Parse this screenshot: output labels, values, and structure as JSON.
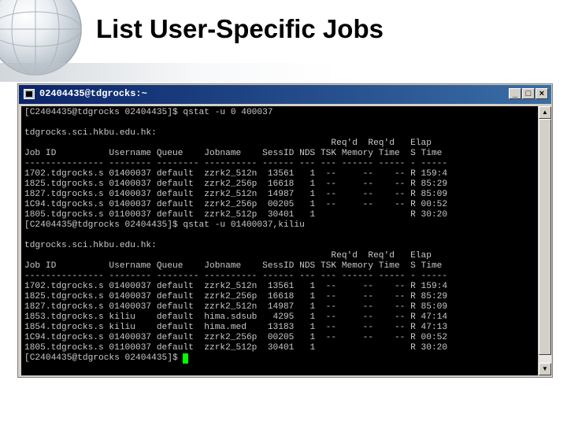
{
  "slide": {
    "title": "List User-Specific Jobs"
  },
  "window": {
    "title": "02404435@tdgrocks:~",
    "buttons": {
      "minimize": "_",
      "maximize": "□",
      "close": "×"
    }
  },
  "terminal": {
    "lines": [
      "[C2404435@tdgrocks 02404435]$ qstat -u 0 400037",
      "",
      "tdgrocks.sci.hkbu.edu.hk:",
      "                                                          Req'd  Req'd   Elap",
      "Job ID          Username Queue    Jobname    SessID NDS TSK Memory Time  S Time",
      "--------------- -------- -------- ---------- ------ --- --- ------ ----- - -----",
      "1702.tdgrocks.s 01400037 default  zzrk2_512n  13561   1  --     --    -- R 159:4",
      "1825.tdgrocks.s 01400037 default  zzrk2_256p  16618   1  --     --    -- R 85:29",
      "1827.tdgrocks.s 01400037 default  zzrk2_512n  14987   1  --     --    -- R 85:09",
      "1C94.tdgrocks.s 01400037 default  zzrk2_256p  00205   1  --     --    -- R 00:52",
      "1805.tdgrocks.s 01100037 default  zzrk2_512p  30401   1                  R 30:20",
      "[C2404435@tdgrocks 02404435]$ qstat -u 01400037,kiliu",
      "",
      "tdgrocks.sci.hkbu.edu.hk:",
      "                                                          Req'd  Req'd   Elap",
      "Job ID          Username Queue    Jobname    SessID NDS TSK Memory Time  S Time",
      "--------------- -------- -------- ---------- ------ --- --- ------ ----- - -----",
      "1702.tdgrocks.s 01400037 default  zzrk2_512n  13561   1  --     --    -- R 159:4",
      "1825.tdgrocks.s 01400037 default  zzrk2_256p  16618   1  --     --    -- R 85:29",
      "1827.tdgrocks.s 01400037 default  zzrk2_512n  14987   1  --     --    -- R 85:09",
      "1853.tdgrocks.s kiliu    default  hima.sdsub   4295   1  --     --    -- R 47:14",
      "1854.tdgrocks.s kiliu    default  hima.med    13183   1  --     --    -- R 47:13",
      "1C94.tdgrocks.s 01400037 default  zzrk2_256p  00205   1  --     --    -- R 00:52",
      "1805.tdgrocks.s 01100037 default  zzrk2_512p  30401   1                  R 30:20",
      "[C2404435@tdgrocks 02404435]$ "
    ]
  },
  "scrollbar": {
    "up_arrow": "▲",
    "down_arrow": "▼"
  },
  "icons": [
    "globe-graphic",
    "terminal-app-icon",
    "cursor-block"
  ],
  "colors": {
    "terminal_bg": "#000000",
    "terminal_text": "#c8c8c8",
    "cursor": "#00ff00",
    "titlebar_start": "#0a246a",
    "titlebar_end": "#3a6ea5"
  }
}
